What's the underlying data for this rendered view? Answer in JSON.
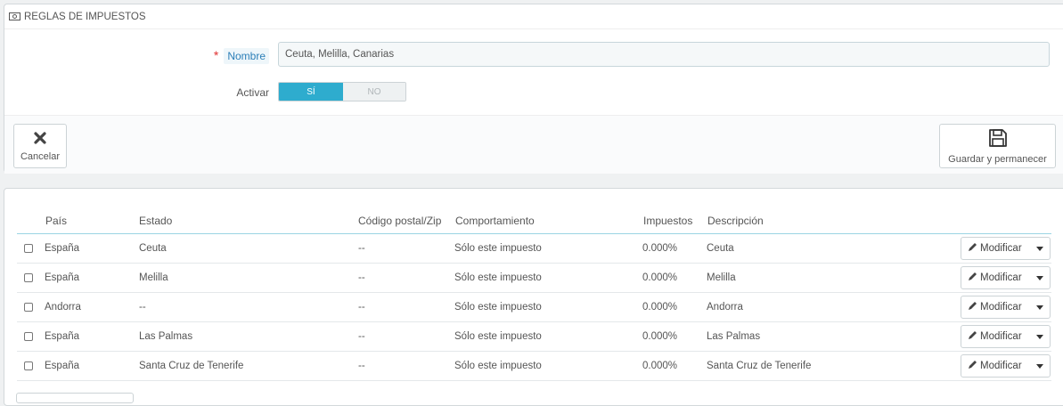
{
  "panel_heading": "REGLAS DE IMPUESTOS",
  "form": {
    "required_mark": "*",
    "name_label": "Nombre",
    "name_value": "Ceuta, Melilla, Canarias",
    "active_label": "Activar",
    "switch_on": "SÍ",
    "switch_off": "NO",
    "switch_state": "on"
  },
  "footer": {
    "cancel_label": "Cancelar",
    "save_stay_label": "Guardar y permanecer"
  },
  "table": {
    "headers": {
      "country": "País",
      "state": "Estado",
      "zip": "Código postal/Zip",
      "behavior": "Comportamiento",
      "tax": "Impuestos",
      "description": "Descripción"
    },
    "rows": [
      {
        "country": "España",
        "state": "Ceuta",
        "zip": "--",
        "behavior": "Sólo este impuesto",
        "tax": "0.000%",
        "description": "Ceuta",
        "action": "Modificar"
      },
      {
        "country": "España",
        "state": "Melilla",
        "zip": "--",
        "behavior": "Sólo este impuesto",
        "tax": "0.000%",
        "description": "Melilla",
        "action": "Modificar"
      },
      {
        "country": "Andorra",
        "state": "--",
        "zip": "--",
        "behavior": "Sólo este impuesto",
        "tax": "0.000%",
        "description": "Andorra",
        "action": "Modificar"
      },
      {
        "country": "España",
        "state": "Las Palmas",
        "zip": "--",
        "behavior": "Sólo este impuesto",
        "tax": "0.000%",
        "description": "Las Palmas",
        "action": "Modificar"
      },
      {
        "country": "España",
        "state": "Santa Cruz de Tenerife",
        "zip": "--",
        "behavior": "Sólo este impuesto",
        "tax": "0.000%",
        "description": "Santa Cruz de Tenerife",
        "action": "Modificar"
      }
    ]
  },
  "icons": {
    "heading": "money-icon",
    "cancel": "close-icon",
    "save": "save-icon",
    "edit": "pencil-icon",
    "dropdown": "caret-down-icon"
  },
  "colors": {
    "accent": "#2eacce",
    "link": "#2c7fb8",
    "required": "#e03131",
    "table_header_border": "#9bd4e4"
  }
}
